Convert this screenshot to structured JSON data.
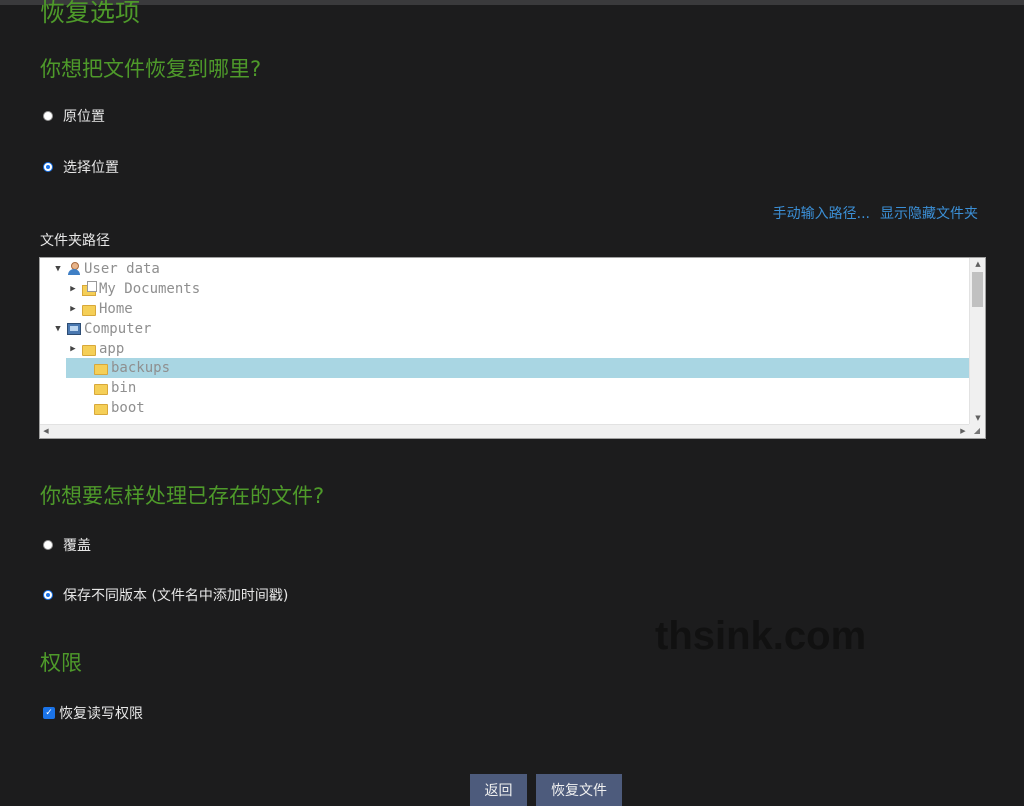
{
  "page": {
    "title": "恢复选项",
    "location_heading": "你想把文件恢复到哪里?",
    "location_options": [
      "原位置",
      "选择位置"
    ],
    "location_selected": 1,
    "links": [
      "手动输入路径...",
      "显示隐藏文件夹"
    ],
    "folder_path_label": "文件夹路径",
    "existing_heading": "你想要怎样处理已存在的文件?",
    "existing_options": [
      "覆盖",
      "保存不同版本 (文件名中添加时间戳)"
    ],
    "existing_selected": 1,
    "permissions_heading": "权限",
    "permissions_checkbox": "恢复读写权限",
    "permissions_checked": true,
    "watermark": "thsink.com",
    "buttons": {
      "back": "返回",
      "restore": "恢复文件"
    }
  },
  "tree": [
    {
      "label": "User data",
      "icon": "user-icon",
      "expanded": true
    },
    {
      "label": "My Documents",
      "icon": "documents-folder-icon",
      "expanded": false
    },
    {
      "label": "Home",
      "icon": "home-folder-icon",
      "expanded": false
    },
    {
      "label": "Computer",
      "icon": "computer-icon",
      "expanded": true
    },
    {
      "label": "app",
      "icon": "folder-icon",
      "expanded": false
    },
    {
      "label": "backups",
      "icon": "folder-icon",
      "selected": true
    },
    {
      "label": "bin",
      "icon": "link-folder-icon"
    },
    {
      "label": "boot",
      "icon": "folder-icon"
    }
  ]
}
